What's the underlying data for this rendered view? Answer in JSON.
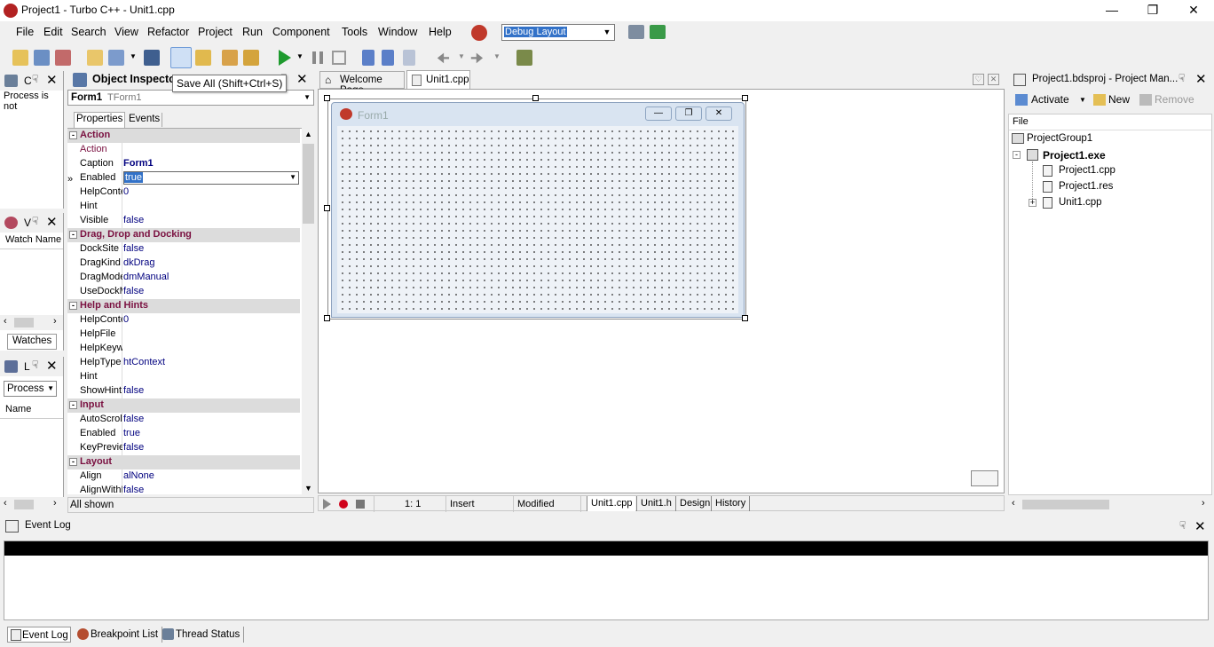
{
  "window": {
    "title": "Project1 - Turbo C++ - Unit1.cpp",
    "minimize_icon": "minimize-icon",
    "maximize_icon": "restore-icon",
    "close_icon": "close-icon"
  },
  "menu": [
    "File",
    "Edit",
    "Search",
    "View",
    "Refactor",
    "Project",
    "Run",
    "Component",
    "Tools",
    "Window",
    "Help"
  ],
  "toolbar": {
    "layout_combo_value": "Debug Layout",
    "tooltip": "Save All (Shift+Ctrl+S)"
  },
  "left_panels": {
    "threads_header_letter": "C",
    "process_text": "Process is not",
    "watch_header_letter": "V",
    "watch_col": "Watch Name",
    "watches_tab": "Watches",
    "local_header_letter": "L",
    "process_combo": "Process",
    "name_col": "Name"
  },
  "object_inspector": {
    "title": "Object Inspector",
    "component_name": "Form1",
    "component_type": "TForm1",
    "tab_properties": "Properties",
    "tab_events": "Events",
    "status": "All shown",
    "rows": [
      {
        "cat": "Action"
      },
      {
        "n": "Action",
        "v": "",
        "red": true
      },
      {
        "n": "Caption",
        "v": "Form1",
        "bold": true
      },
      {
        "n": "Enabled",
        "v": "true",
        "selected": true
      },
      {
        "n": "HelpContext",
        "v": "0"
      },
      {
        "n": "Hint",
        "v": ""
      },
      {
        "n": "Visible",
        "v": "false"
      },
      {
        "cat": "Drag, Drop and Docking"
      },
      {
        "n": "DockSite",
        "v": "false"
      },
      {
        "n": "DragKind",
        "v": "dkDrag"
      },
      {
        "n": "DragMode",
        "v": "dmManual"
      },
      {
        "n": "UseDockManager",
        "v": "false"
      },
      {
        "cat": "Help and Hints"
      },
      {
        "n": "HelpContext",
        "v": "0"
      },
      {
        "n": "HelpFile",
        "v": ""
      },
      {
        "n": "HelpKeyword",
        "v": ""
      },
      {
        "n": "HelpType",
        "v": "htContext"
      },
      {
        "n": "Hint",
        "v": ""
      },
      {
        "n": "ShowHint",
        "v": "false"
      },
      {
        "cat": "Input"
      },
      {
        "n": "AutoScroll",
        "v": "false"
      },
      {
        "n": "Enabled",
        "v": "true"
      },
      {
        "n": "KeyPreview",
        "v": "false"
      },
      {
        "cat": "Layout"
      },
      {
        "n": "Align",
        "v": "alNone"
      },
      {
        "n": "AlignWithMargins",
        "v": "false"
      }
    ]
  },
  "editor": {
    "tabs": [
      "Welcome Page",
      "Unit1.cpp"
    ],
    "form_caption": "Form1",
    "status": {
      "position": "1:   1",
      "mode": "Insert",
      "modified": "Modified"
    },
    "bottom_tabs": [
      "Unit1.cpp",
      "Unit1.h",
      "Design",
      "History"
    ]
  },
  "project_manager": {
    "title": "Project1.bdsproj - Project Man...",
    "activate": "Activate",
    "new": "New",
    "remove": "Remove",
    "file_col": "File",
    "tree": [
      {
        "label": "ProjectGroup1",
        "bold": false
      },
      {
        "label": "Project1.exe",
        "bold": true
      },
      {
        "label": "Project1.cpp",
        "bold": false
      },
      {
        "label": "Project1.res",
        "bold": false
      },
      {
        "label": "Unit1.cpp",
        "bold": false
      }
    ]
  },
  "event_log": {
    "title": "Event Log",
    "tabs": [
      "Event Log",
      "Breakpoint List",
      "Thread Status"
    ]
  }
}
